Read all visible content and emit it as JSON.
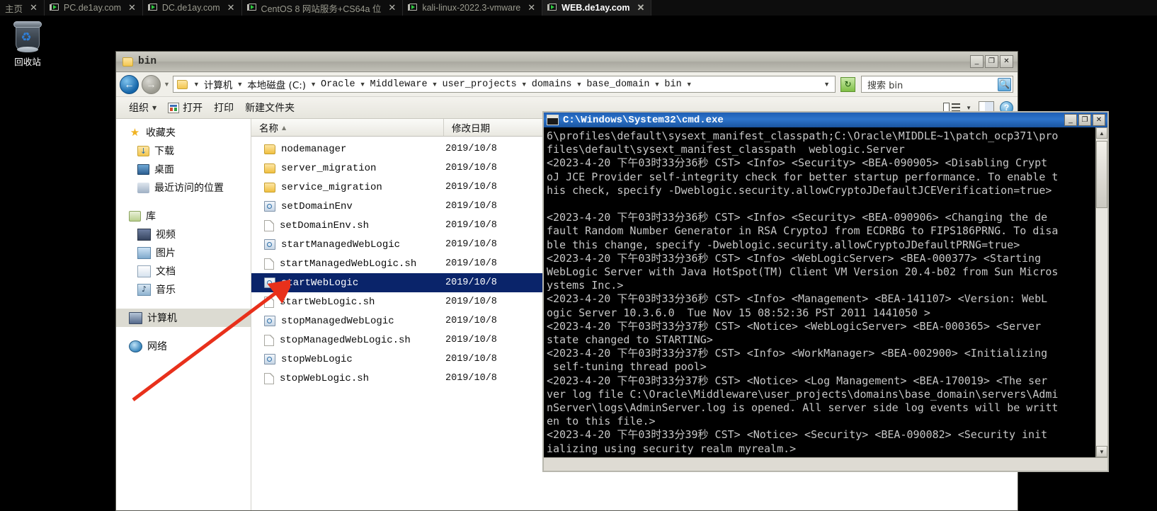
{
  "tabstrip": {
    "tabs": [
      {
        "label": "主页",
        "icon": "",
        "active": false,
        "close": "✕"
      },
      {
        "label": "PC.de1ay.com",
        "icon": "vm-icon",
        "active": false,
        "close": "✕"
      },
      {
        "label": "DC.de1ay.com",
        "icon": "vm-icon",
        "active": false,
        "close": "✕"
      },
      {
        "label": "CentOS 8 网站服务+CS64a 位",
        "icon": "vm-icon",
        "active": false,
        "close": "✕"
      },
      {
        "label": "kali-linux-2022.3-vmware",
        "icon": "vm-icon",
        "active": false,
        "close": "✕"
      },
      {
        "label": "WEB.de1ay.com",
        "icon": "vm-icon",
        "active": true,
        "close": "✕"
      }
    ]
  },
  "desktop": {
    "recycle_bin_label": "回收站",
    "recycle_bin_icon": "recycle-bin-icon"
  },
  "explorer": {
    "title": "bin",
    "title_icon": "folder-icon",
    "window_buttons": {
      "minimize": "_",
      "maximize": "❐",
      "close": "✕"
    },
    "address": {
      "back_icon": "←",
      "forward_icon": "→",
      "history_caret": "▼",
      "folder_icon": "folder-icon",
      "leading_caret": "▼",
      "crumbs": [
        "计算机",
        "本地磁盘 (C:)",
        "Oracle",
        "Middleware",
        "user_projects",
        "domains",
        "base_domain",
        "bin"
      ],
      "crumb_caret": "▼",
      "dropdown_caret": "▼",
      "refresh_icon": "↻"
    },
    "search": {
      "placeholder": "搜索 bin",
      "value": "",
      "icon": "search-icon"
    },
    "toolbar": {
      "organize": "组织",
      "organize_caret": "▼",
      "open": "打开",
      "open_icon": "open-file-icon",
      "print": "打印",
      "new_folder": "新建文件夹",
      "view_caret": "▼",
      "help": "?"
    },
    "navpane": {
      "groups": [
        {
          "header": {
            "label": "收藏夹",
            "icon": "star-icon"
          },
          "items": [
            {
              "label": "下载",
              "icon": "downloads-icon"
            },
            {
              "label": "桌面",
              "icon": "desktop-icon"
            },
            {
              "label": "最近访问的位置",
              "icon": "recent-places-icon"
            }
          ]
        },
        {
          "header": {
            "label": "库",
            "icon": "library-icon"
          },
          "items": [
            {
              "label": "视频",
              "icon": "video-icon"
            },
            {
              "label": "图片",
              "icon": "pictures-icon"
            },
            {
              "label": "文档",
              "icon": "documents-icon"
            },
            {
              "label": "音乐",
              "icon": "music-icon"
            }
          ]
        },
        {
          "header": {
            "label": "计算机",
            "icon": "computer-icon",
            "selected": true
          },
          "items": []
        },
        {
          "header": {
            "label": "网络",
            "icon": "network-icon"
          },
          "items": []
        }
      ]
    },
    "filelist": {
      "columns": [
        {
          "label": "名称",
          "sort": "▲"
        },
        {
          "label": "修改日期",
          "sort": ""
        }
      ],
      "rows": [
        {
          "name": "nodemanager",
          "date": "2019/10/8",
          "type": "folder",
          "selected": false
        },
        {
          "name": "server_migration",
          "date": "2019/10/8",
          "type": "folder",
          "selected": false
        },
        {
          "name": "service_migration",
          "date": "2019/10/8",
          "type": "folder",
          "selected": false
        },
        {
          "name": "setDomainEnv",
          "date": "2019/10/8",
          "type": "cmd",
          "selected": false
        },
        {
          "name": "setDomainEnv.sh",
          "date": "2019/10/8",
          "type": "sh",
          "selected": false
        },
        {
          "name": "startManagedWebLogic",
          "date": "2019/10/8",
          "type": "cmd",
          "selected": false
        },
        {
          "name": "startManagedWebLogic.sh",
          "date": "2019/10/8",
          "type": "sh",
          "selected": false
        },
        {
          "name": "startWebLogic",
          "date": "2019/10/8",
          "type": "cmd",
          "selected": true
        },
        {
          "name": "startWebLogic.sh",
          "date": "2019/10/8",
          "type": "sh",
          "selected": false
        },
        {
          "name": "stopManagedWebLogic",
          "date": "2019/10/8",
          "type": "cmd",
          "selected": false
        },
        {
          "name": "stopManagedWebLogic.sh",
          "date": "2019/10/8",
          "type": "sh",
          "selected": false
        },
        {
          "name": "stopWebLogic",
          "date": "2019/10/8",
          "type": "cmd",
          "selected": false
        },
        {
          "name": "stopWebLogic.sh",
          "date": "2019/10/8",
          "type": "sh",
          "selected": false
        }
      ]
    }
  },
  "cmd": {
    "title": "C:\\Windows\\System32\\cmd.exe",
    "title_icon": "cmd-icon",
    "window_buttons": {
      "minimize": "_",
      "maximize": "❐",
      "close": "✕"
    },
    "scrollbar": {
      "up": "▲",
      "down": "▼"
    },
    "console_text": "6\\profiles\\default\\sysext_manifest_classpath;C:\\Oracle\\MIDDLE~1\\patch_ocp371\\pro\nfiles\\default\\sysext_manifest_classpath  weblogic.Server\n<2023-4-20 下午03时33分36秒 CST> <Info> <Security> <BEA-090905> <Disabling Crypt\noJ JCE Provider self-integrity check for better startup performance. To enable t\nhis check, specify -Dweblogic.security.allowCryptoJDefaultJCEVerification=true>\n\n<2023-4-20 下午03时33分36秒 CST> <Info> <Security> <BEA-090906> <Changing the de\nfault Random Number Generator in RSA CryptoJ from ECDRBG to FIPS186PRNG. To disa\nble this change, specify -Dweblogic.security.allowCryptoJDefaultPRNG=true>\n<2023-4-20 下午03时33分36秒 CST> <Info> <WebLogicServer> <BEA-000377> <Starting\nWebLogic Server with Java HotSpot(TM) Client VM Version 20.4-b02 from Sun Micros\nystems Inc.>\n<2023-4-20 下午03时33分36秒 CST> <Info> <Management> <BEA-141107> <Version: WebL\nogic Server 10.3.6.0  Tue Nov 15 08:52:36 PST 2011 1441050 >\n<2023-4-20 下午03时33分37秒 CST> <Notice> <WebLogicServer> <BEA-000365> <Server\nstate changed to STARTING>\n<2023-4-20 下午03时33分37秒 CST> <Info> <WorkManager> <BEA-002900> <Initializing\n self-tuning thread pool>\n<2023-4-20 下午03时33分37秒 CST> <Notice> <Log Management> <BEA-170019> <The ser\nver log file C:\\Oracle\\Middleware\\user_projects\\domains\\base_domain\\servers\\Admi\nnServer\\logs\\AdminServer.log is opened. All server side log events will be writt\nen to this file.>\n<2023-4-20 下午03时33分39秒 CST> <Notice> <Security> <BEA-090082> <Security init\nializing using security realm myrealm.>"
  },
  "annotation": {
    "arrow_color": "#e8301b",
    "arrow_name": "red-pointer-arrow"
  }
}
